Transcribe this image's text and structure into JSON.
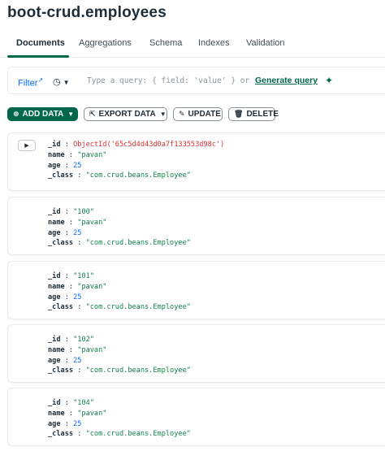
{
  "header": {
    "db": "boot-crud",
    "dot": ".",
    "collection": "employees"
  },
  "tabs": [
    "Documents",
    "Aggregations",
    "Schema",
    "Indexes",
    "Validation"
  ],
  "query": {
    "filter_label": "Filter",
    "placeholder": "Type a query: { field: 'value' } or",
    "generate_label": "Generate query"
  },
  "toolbar": {
    "add_label": "ADD DATA",
    "export_label": "EXPORT DATA",
    "update_label": "UPDATE",
    "delete_label": "DELETE"
  },
  "documents": [
    {
      "id_display": "ObjectId('65c5d4d43d0a7f133553d98c')",
      "name": "\"pavan\"",
      "age": "25",
      "class": "\"com.crud.beans.Employee\""
    },
    {
      "id_display": "\"100\"",
      "name": "\"pavan\"",
      "age": "25",
      "class": "\"com.crud.beans.Employee\""
    },
    {
      "id_display": "\"101\"",
      "name": "\"pavan\"",
      "age": "25",
      "class": "\"com.crud.beans.Employee\""
    },
    {
      "id_display": "\"102\"",
      "name": "\"pavan\"",
      "age": "25",
      "class": "\"com.crud.beans.Employee\""
    },
    {
      "id_display": "\"104\"",
      "name": "\"pavan\"",
      "age": "25",
      "class": "\"com.crud.beans.Employee\""
    }
  ],
  "field_keys": {
    "id": "_id",
    "name": "name",
    "age": "age",
    "class": "_class"
  },
  "colors": {
    "accent": "#00684a",
    "link": "#016bf8",
    "string": "#12824d",
    "objectid": "#db3030"
  },
  "icons": [
    "external-link-icon",
    "clock-icon",
    "chevron-down-icon",
    "sparkle-icon",
    "plus-circle-icon",
    "export-icon",
    "pencil-icon",
    "trash-icon",
    "expand-caret-icon"
  ]
}
